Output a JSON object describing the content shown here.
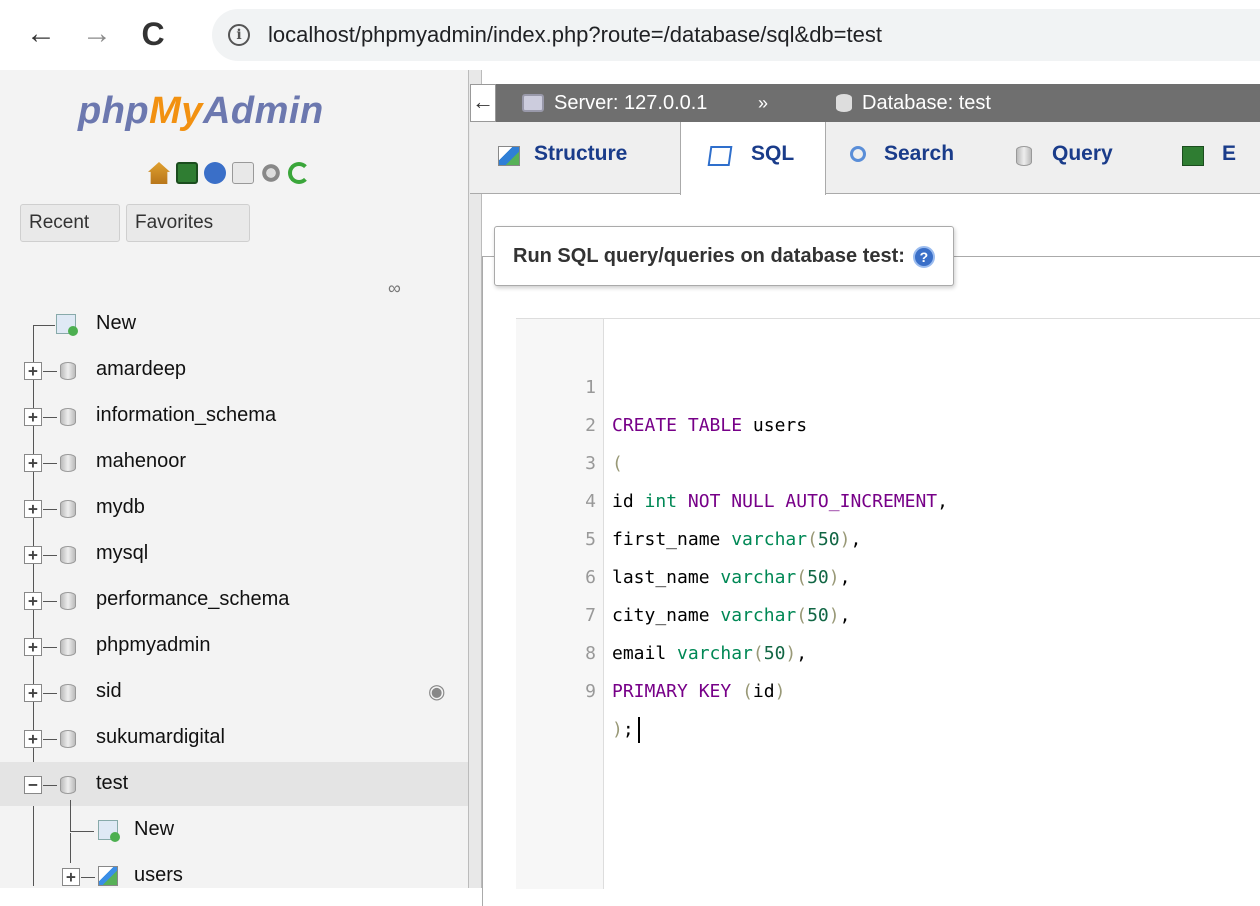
{
  "browser": {
    "url": "localhost/phpmyadmin/index.php?route=/database/sql&db=test",
    "back_glyph": "←",
    "forward_glyph": "→",
    "reload_glyph": "C"
  },
  "sidebar": {
    "logo": {
      "php": "php",
      "my": "My",
      "admin": "Admin"
    },
    "tabs": {
      "recent": "Recent",
      "favorites": "Favorites"
    },
    "tree": {
      "new_label": "New",
      "databases": [
        "amardeep",
        "information_schema",
        "mahenoor",
        "mydb",
        "mysql",
        "performance_schema",
        "phpmyadmin",
        "sid",
        "sukumardigital",
        "test"
      ],
      "test_children": {
        "new_label": "New",
        "table": "users"
      }
    }
  },
  "main": {
    "breadcrumb": {
      "server": "Server: 127.0.0.1",
      "separator": "»",
      "database": "Database: test"
    },
    "tabs": [
      "Structure",
      "SQL",
      "Search",
      "Query",
      "E"
    ],
    "active_tab": "SQL",
    "legend": "Run SQL query/queries on database test:",
    "code_lines": [
      "CREATE TABLE users",
      "(",
      "id int NOT NULL AUTO_INCREMENT,",
      "first_name varchar(50),",
      "last_name varchar(50),",
      "city_name varchar(50),",
      "email varchar(50),",
      "PRIMARY KEY (id)",
      ");"
    ],
    "line_numbers": [
      "1",
      "2",
      "3",
      "4",
      "5",
      "6",
      "7",
      "8",
      "9"
    ]
  }
}
